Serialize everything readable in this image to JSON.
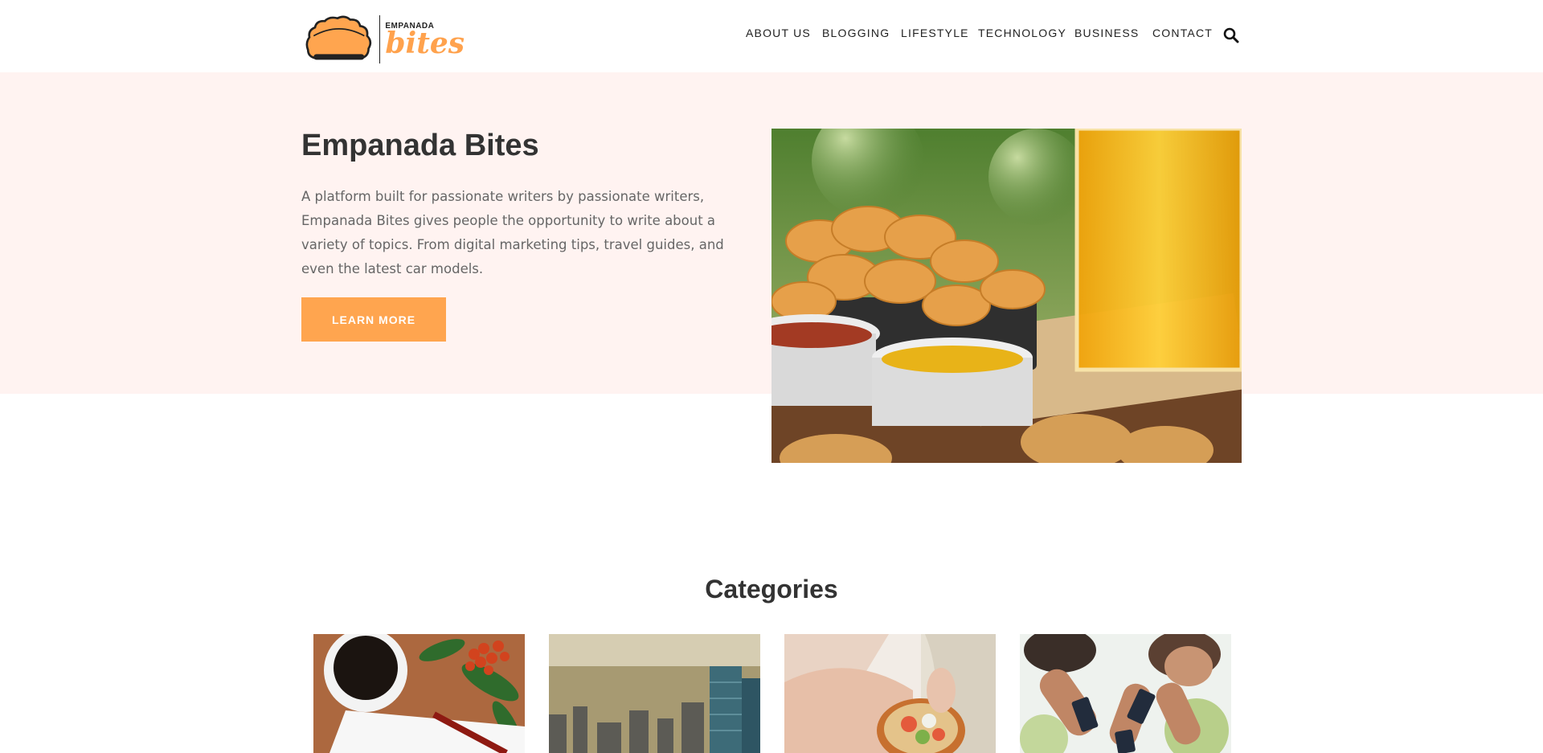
{
  "header": {
    "logo": {
      "small_text": "EMPANADA",
      "big_text": "bites"
    },
    "nav": [
      {
        "label": "ABOUT US"
      },
      {
        "label": "BLOGGING"
      },
      {
        "label": "LIFESTYLE"
      },
      {
        "label": "TECHNOLOGY"
      },
      {
        "label": "BUSINESS"
      },
      {
        "label": "CONTACT"
      }
    ],
    "search_icon": "search-icon"
  },
  "hero": {
    "title": "Empanada Bites",
    "description": "A platform built for passionate writers by passionate writers, Empanada Bites gives people the opportunity to write about a variety of topics. From digital marketing tips, travel guides, and even the latest car models.",
    "button_label": "LEARN MORE"
  },
  "categories": {
    "title": "Categories",
    "cards": [
      {
        "image": "coffee-notebook-image"
      },
      {
        "image": "city-skyline-image"
      },
      {
        "image": "salad-bowl-image"
      },
      {
        "image": "people-phones-image"
      }
    ]
  },
  "colors": {
    "accent": "#ffa54f",
    "hero_bg": "#fff3f1",
    "text_dark": "#333333",
    "text_muted": "#666666"
  }
}
